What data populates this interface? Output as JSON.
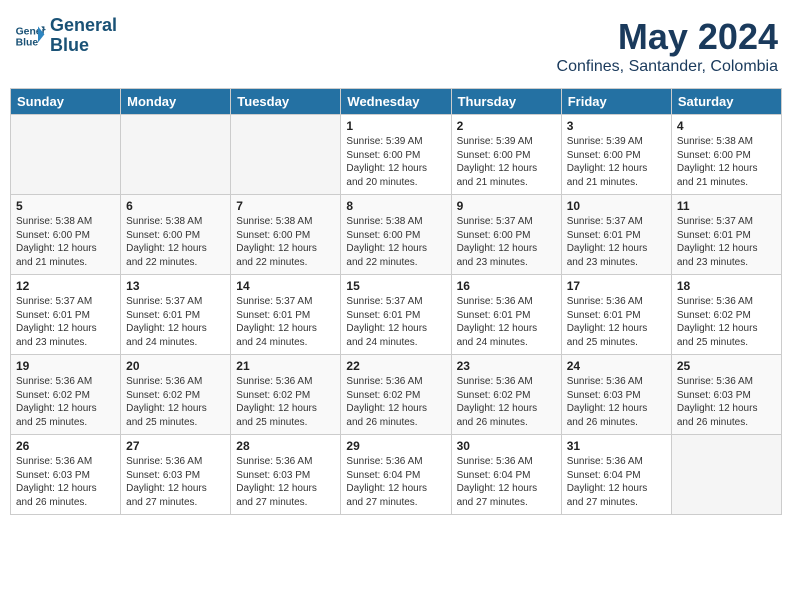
{
  "header": {
    "logo_line1": "General",
    "logo_line2": "Blue",
    "title": "May 2024",
    "subtitle": "Confines, Santander, Colombia"
  },
  "days_of_week": [
    "Sunday",
    "Monday",
    "Tuesday",
    "Wednesday",
    "Thursday",
    "Friday",
    "Saturday"
  ],
  "weeks": [
    [
      {
        "day": "",
        "info": ""
      },
      {
        "day": "",
        "info": ""
      },
      {
        "day": "",
        "info": ""
      },
      {
        "day": "1",
        "info": "Sunrise: 5:39 AM\nSunset: 6:00 PM\nDaylight: 12 hours\nand 20 minutes."
      },
      {
        "day": "2",
        "info": "Sunrise: 5:39 AM\nSunset: 6:00 PM\nDaylight: 12 hours\nand 21 minutes."
      },
      {
        "day": "3",
        "info": "Sunrise: 5:39 AM\nSunset: 6:00 PM\nDaylight: 12 hours\nand 21 minutes."
      },
      {
        "day": "4",
        "info": "Sunrise: 5:38 AM\nSunset: 6:00 PM\nDaylight: 12 hours\nand 21 minutes."
      }
    ],
    [
      {
        "day": "5",
        "info": "Sunrise: 5:38 AM\nSunset: 6:00 PM\nDaylight: 12 hours\nand 21 minutes."
      },
      {
        "day": "6",
        "info": "Sunrise: 5:38 AM\nSunset: 6:00 PM\nDaylight: 12 hours\nand 22 minutes."
      },
      {
        "day": "7",
        "info": "Sunrise: 5:38 AM\nSunset: 6:00 PM\nDaylight: 12 hours\nand 22 minutes."
      },
      {
        "day": "8",
        "info": "Sunrise: 5:38 AM\nSunset: 6:00 PM\nDaylight: 12 hours\nand 22 minutes."
      },
      {
        "day": "9",
        "info": "Sunrise: 5:37 AM\nSunset: 6:00 PM\nDaylight: 12 hours\nand 23 minutes."
      },
      {
        "day": "10",
        "info": "Sunrise: 5:37 AM\nSunset: 6:01 PM\nDaylight: 12 hours\nand 23 minutes."
      },
      {
        "day": "11",
        "info": "Sunrise: 5:37 AM\nSunset: 6:01 PM\nDaylight: 12 hours\nand 23 minutes."
      }
    ],
    [
      {
        "day": "12",
        "info": "Sunrise: 5:37 AM\nSunset: 6:01 PM\nDaylight: 12 hours\nand 23 minutes."
      },
      {
        "day": "13",
        "info": "Sunrise: 5:37 AM\nSunset: 6:01 PM\nDaylight: 12 hours\nand 24 minutes."
      },
      {
        "day": "14",
        "info": "Sunrise: 5:37 AM\nSunset: 6:01 PM\nDaylight: 12 hours\nand 24 minutes."
      },
      {
        "day": "15",
        "info": "Sunrise: 5:37 AM\nSunset: 6:01 PM\nDaylight: 12 hours\nand 24 minutes."
      },
      {
        "day": "16",
        "info": "Sunrise: 5:36 AM\nSunset: 6:01 PM\nDaylight: 12 hours\nand 24 minutes."
      },
      {
        "day": "17",
        "info": "Sunrise: 5:36 AM\nSunset: 6:01 PM\nDaylight: 12 hours\nand 25 minutes."
      },
      {
        "day": "18",
        "info": "Sunrise: 5:36 AM\nSunset: 6:02 PM\nDaylight: 12 hours\nand 25 minutes."
      }
    ],
    [
      {
        "day": "19",
        "info": "Sunrise: 5:36 AM\nSunset: 6:02 PM\nDaylight: 12 hours\nand 25 minutes."
      },
      {
        "day": "20",
        "info": "Sunrise: 5:36 AM\nSunset: 6:02 PM\nDaylight: 12 hours\nand 25 minutes."
      },
      {
        "day": "21",
        "info": "Sunrise: 5:36 AM\nSunset: 6:02 PM\nDaylight: 12 hours\nand 25 minutes."
      },
      {
        "day": "22",
        "info": "Sunrise: 5:36 AM\nSunset: 6:02 PM\nDaylight: 12 hours\nand 26 minutes."
      },
      {
        "day": "23",
        "info": "Sunrise: 5:36 AM\nSunset: 6:02 PM\nDaylight: 12 hours\nand 26 minutes."
      },
      {
        "day": "24",
        "info": "Sunrise: 5:36 AM\nSunset: 6:03 PM\nDaylight: 12 hours\nand 26 minutes."
      },
      {
        "day": "25",
        "info": "Sunrise: 5:36 AM\nSunset: 6:03 PM\nDaylight: 12 hours\nand 26 minutes."
      }
    ],
    [
      {
        "day": "26",
        "info": "Sunrise: 5:36 AM\nSunset: 6:03 PM\nDaylight: 12 hours\nand 26 minutes."
      },
      {
        "day": "27",
        "info": "Sunrise: 5:36 AM\nSunset: 6:03 PM\nDaylight: 12 hours\nand 27 minutes."
      },
      {
        "day": "28",
        "info": "Sunrise: 5:36 AM\nSunset: 6:03 PM\nDaylight: 12 hours\nand 27 minutes."
      },
      {
        "day": "29",
        "info": "Sunrise: 5:36 AM\nSunset: 6:04 PM\nDaylight: 12 hours\nand 27 minutes."
      },
      {
        "day": "30",
        "info": "Sunrise: 5:36 AM\nSunset: 6:04 PM\nDaylight: 12 hours\nand 27 minutes."
      },
      {
        "day": "31",
        "info": "Sunrise: 5:36 AM\nSunset: 6:04 PM\nDaylight: 12 hours\nand 27 minutes."
      },
      {
        "day": "",
        "info": ""
      }
    ]
  ]
}
